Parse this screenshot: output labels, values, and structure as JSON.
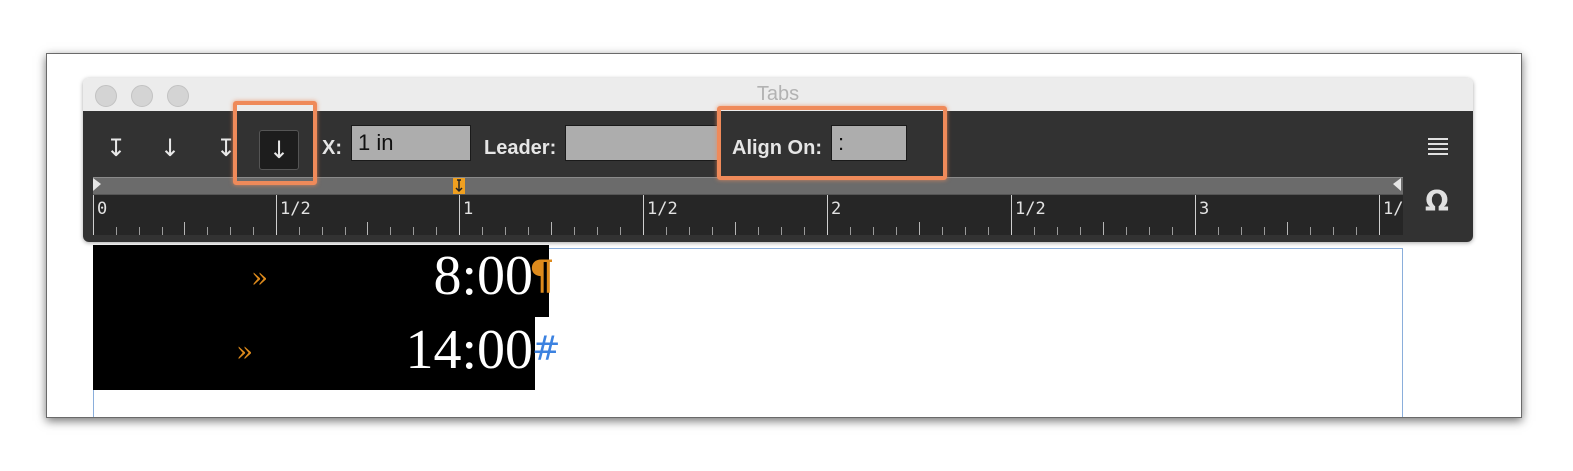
{
  "panel": {
    "title": "Tabs",
    "tab_buttons": [
      {
        "icon": "left-justified-tab-icon",
        "glyph": "↧"
      },
      {
        "icon": "center-justified-tab-icon",
        "glyph": "↓"
      },
      {
        "icon": "right-justified-tab-icon",
        "glyph": "↧"
      },
      {
        "icon": "align-to-decimal-tab-icon",
        "glyph": "↓",
        "selected": true
      }
    ],
    "x_label": "X:",
    "x_value": "1 in",
    "leader_label": "Leader:",
    "leader_value": "",
    "align_on_label": "Align On:",
    "align_on_value": ":",
    "ruler_labels": [
      "0",
      "1/2",
      "1",
      "1/2",
      "2",
      "1/2",
      "3",
      "1/"
    ],
    "menu_icon": "panel-menu-icon",
    "snap_icon": "position-panel-above-text-frame-icon"
  },
  "document": {
    "lines": [
      {
        "tab_marker": "»",
        "text": "8:00",
        "end_marker": "¶"
      },
      {
        "tab_marker": "»",
        "text": "14:00",
        "end_marker": "#"
      }
    ]
  },
  "colors": {
    "accent_highlight": "#ef8a5a",
    "panel_background": "#323232",
    "tab_marker": "#dd8a1c",
    "frame_edge": "#8aaedb"
  }
}
